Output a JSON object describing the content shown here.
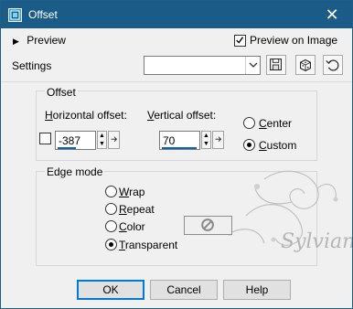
{
  "window": {
    "title": "Offset",
    "close_label": "✕"
  },
  "top": {
    "preview_label": "Preview",
    "preview_on_image_label": "Preview on Image",
    "preview_on_image_checked": true,
    "settings_label": "Settings",
    "settings_value": ""
  },
  "offset": {
    "group_label": "Offset",
    "horizontal": {
      "label_accel": "H",
      "label_rest": "orizontal offset:",
      "value": "-387"
    },
    "vertical": {
      "label_accel": "V",
      "label_rest": "ertical offset:",
      "value": "70"
    },
    "center_accel": "C",
    "center_rest": "enter",
    "custom_accel": "C",
    "custom_rest": "ustom",
    "selected": "custom"
  },
  "edge_mode": {
    "group_label": "Edge mode",
    "options": [
      {
        "accel": "W",
        "rest": "rap"
      },
      {
        "accel": "R",
        "rest": "epeat"
      },
      {
        "accel": "C",
        "rest": "olor"
      },
      {
        "accel": "T",
        "rest": "ransparent"
      }
    ],
    "selected": "Transparent"
  },
  "watermark": {
    "text": "Sylviane"
  },
  "buttons": {
    "ok": "OK",
    "cancel": "Cancel",
    "help": "Help"
  }
}
